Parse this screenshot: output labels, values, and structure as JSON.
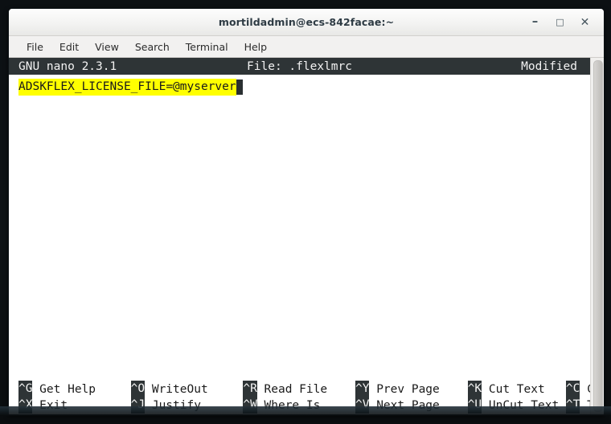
{
  "window": {
    "title": "mortildadmin@ecs-842facae:~",
    "controls": {
      "minimize": "–",
      "maximize": "□",
      "close": "✕"
    }
  },
  "menubar": {
    "items": [
      {
        "label": "File"
      },
      {
        "label": "Edit"
      },
      {
        "label": "View"
      },
      {
        "label": "Search"
      },
      {
        "label": "Terminal"
      },
      {
        "label": "Help"
      }
    ]
  },
  "nano": {
    "version": "GNU nano 2.3.1",
    "file_label": "File: .flexlmrc",
    "status": "Modified",
    "buffer": {
      "lines": [
        {
          "text": "ADSKFLEX_LICENSE_FILE=@myserver",
          "highlighted": true,
          "cursor_after": true
        }
      ]
    },
    "shortcuts_row1": [
      {
        "key": "^G",
        "label": "Get Help"
      },
      {
        "key": "^O",
        "label": "WriteOut"
      },
      {
        "key": "^R",
        "label": "Read File"
      },
      {
        "key": "^Y",
        "label": "Prev Page"
      },
      {
        "key": "^K",
        "label": "Cut Text"
      },
      {
        "key": "^C",
        "label": "Cur Pos"
      }
    ],
    "shortcuts_row2": [
      {
        "key": "^X",
        "label": "Exit"
      },
      {
        "key": "^J",
        "label": "Justify"
      },
      {
        "key": "^W",
        "label": "Where Is"
      },
      {
        "key": "^V",
        "label": "Next Page"
      },
      {
        "key": "^U",
        "label": "UnCut Text"
      },
      {
        "key": "^T",
        "label": "To Spell"
      }
    ]
  },
  "colors": {
    "nano_bar_bg": "#2e3436",
    "nano_bar_fg": "#f2f2f2",
    "highlight_bg": "#ffff00",
    "terminal_bg": "#ffffff",
    "terminal_fg": "#1a1a1a",
    "titlebar_fg": "#2e3b44",
    "desktop_bg": "#0c1013"
  }
}
